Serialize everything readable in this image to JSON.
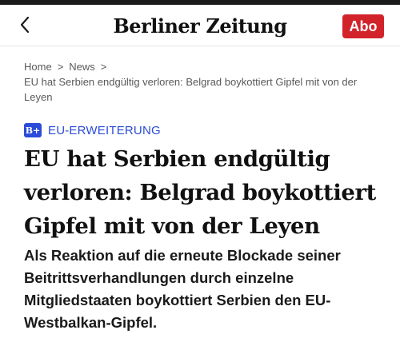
{
  "header": {
    "back_icon": "chevron-left-icon",
    "logo": {
      "word_left": "Berliner",
      "word_right": "Zeitung",
      "crest_icon": "bear-crest-icon"
    },
    "abo_label": "Abo"
  },
  "breadcrumb": {
    "items": [
      "Home",
      "News"
    ],
    "separator": ">",
    "current": "EU hat Serbien endgültig verloren: Belgrad boykottiert Gipfel mit von der Leyen"
  },
  "article": {
    "plus_badge": "B+",
    "category": "EU-ERWEITERUNG",
    "headline": "EU hat Serbien endgültig verloren: Belgrad boykottiert Gipfel mit von der Leyen",
    "lead": "Als Reaktion auf die erneute Blockade seiner Beitrittsverhandlungen durch einzelne Mitgliedstaaten boykottiert Serbien den EU-Westbalkan-Gipfel."
  },
  "colors": {
    "accent_red": "#d2232a",
    "category_blue": "#2b4bd8",
    "text_dark": "#111111",
    "text_muted": "#595959"
  }
}
